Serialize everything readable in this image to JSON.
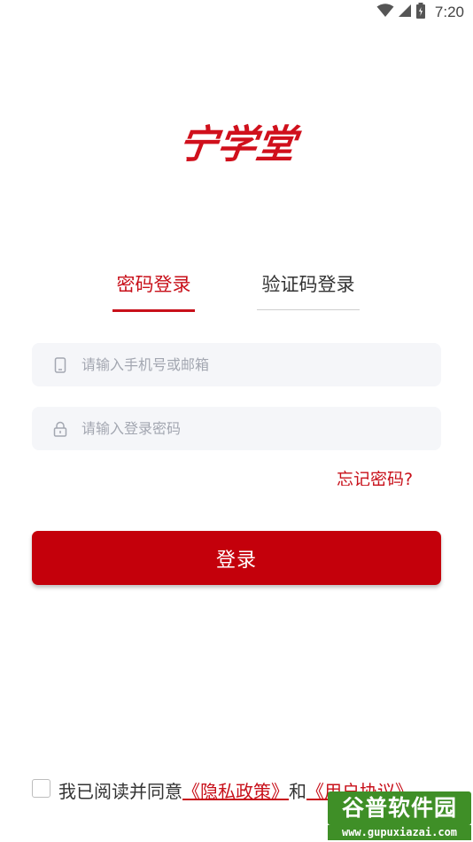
{
  "status_bar": {
    "time": "7:20",
    "icons": [
      "wifi-icon",
      "signal-icon",
      "battery-icon"
    ]
  },
  "logo": {
    "text": "宁学堂",
    "color": "#d0101c"
  },
  "tabs": [
    {
      "label": "密码登录",
      "active": true
    },
    {
      "label": "验证码登录",
      "active": false
    }
  ],
  "form": {
    "phone_placeholder": "请输入手机号或邮箱",
    "phone_value": "",
    "password_placeholder": "请输入登录密码",
    "password_value": "",
    "forgot_label": "忘记密码?",
    "login_label": "登录"
  },
  "agreement": {
    "prefix": "我已阅读并同意",
    "privacy_link": "《隐私政策》",
    "connector": "和",
    "terms_link": "《用户协议》",
    "checked": false
  },
  "watermark": {
    "title": "谷普软件园",
    "url": "www.gupuxiazai.com"
  },
  "colors": {
    "accent": "#c8101a",
    "button": "#c4000b",
    "input_bg": "#f5f6f9",
    "placeholder": "#a3a7b1"
  }
}
